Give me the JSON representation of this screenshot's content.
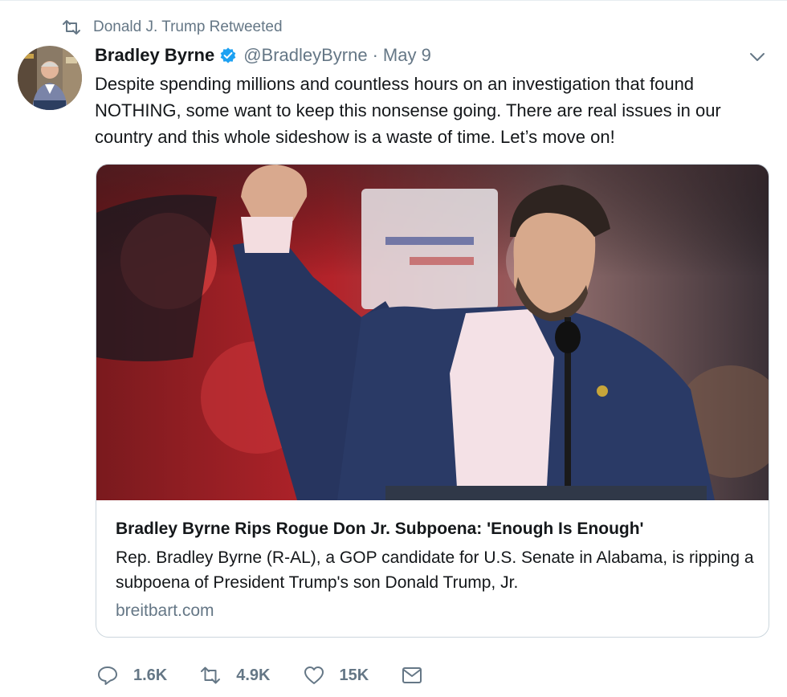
{
  "retweet_context": {
    "text": "Donald J. Trump Retweeted"
  },
  "author": {
    "name": "Bradley Byrne",
    "handle": "@BradleyByrne",
    "separator": "·",
    "date": "May 9"
  },
  "tweet": {
    "text": "Despite spending millions and countless hours on an investigation that found NOTHING, some want to keep this nonsense going. There are real issues in our country and this whole sideshow is a waste of time. Let’s move on!"
  },
  "card": {
    "title": "Bradley Byrne Rips Rogue Don Jr. Subpoena: 'Enough Is Enough'",
    "description": "Rep. Bradley Byrne (R-AL), a GOP candidate for U.S. Senate in Alabama, is ripping a subpoena of President Trump's son Donald Trump, Jr.",
    "domain": "breitbart.com"
  },
  "actions": {
    "reply": {
      "icon": "reply-icon",
      "count": "1.6K"
    },
    "retweet": {
      "icon": "retweet-icon",
      "count": "4.9K"
    },
    "like": {
      "icon": "heart-icon",
      "count": "15K"
    },
    "message": {
      "icon": "envelope-icon"
    }
  },
  "colors": {
    "text": "#14171a",
    "secondary": "#657786",
    "verified": "#1da1f2",
    "border": "#ccd6dd"
  }
}
